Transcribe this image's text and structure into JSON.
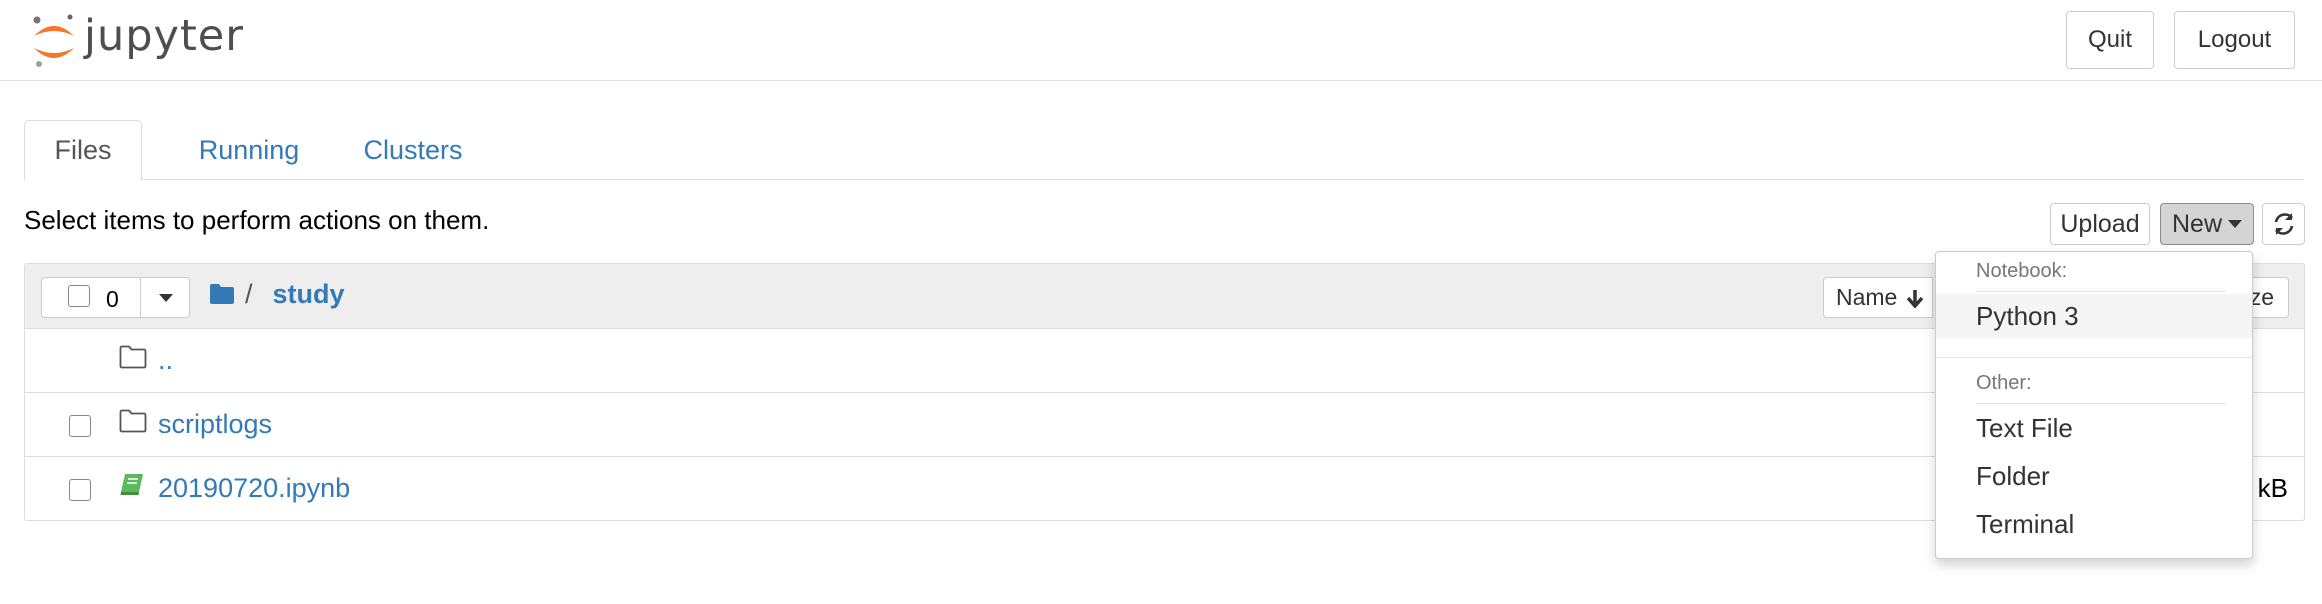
{
  "header": {
    "logo_text": "jupyter",
    "quit_label": "Quit",
    "logout_label": "Logout"
  },
  "tabs": [
    {
      "label": "Files",
      "active": true
    },
    {
      "label": "Running",
      "active": false
    },
    {
      "label": "Clusters",
      "active": false
    }
  ],
  "toolbar": {
    "hint": "Select items to perform actions on them.",
    "upload_label": "Upload",
    "new_label": "New",
    "refresh_icon": "refresh-icon"
  },
  "list": {
    "selected_count": "0",
    "breadcrumb_sep": "/",
    "breadcrumb_current": "study",
    "sort_name_label": "Name",
    "sort_size_label": "ze",
    "rows": [
      {
        "name": "..",
        "type": "folder",
        "size": ""
      },
      {
        "name": "scriptlogs",
        "type": "folder",
        "size": ""
      },
      {
        "name": "20190720.ipynb",
        "type": "notebook",
        "size": "kB"
      }
    ]
  },
  "new_menu": {
    "notebook_header": "Notebook:",
    "python3": "Python 3",
    "other_header": "Other:",
    "text_file": "Text File",
    "folder": "Folder",
    "terminal": "Terminal"
  },
  "colors": {
    "link": "#337ab7",
    "notebook_icon": "#5cb85c",
    "logo_orange": "#f37726"
  }
}
